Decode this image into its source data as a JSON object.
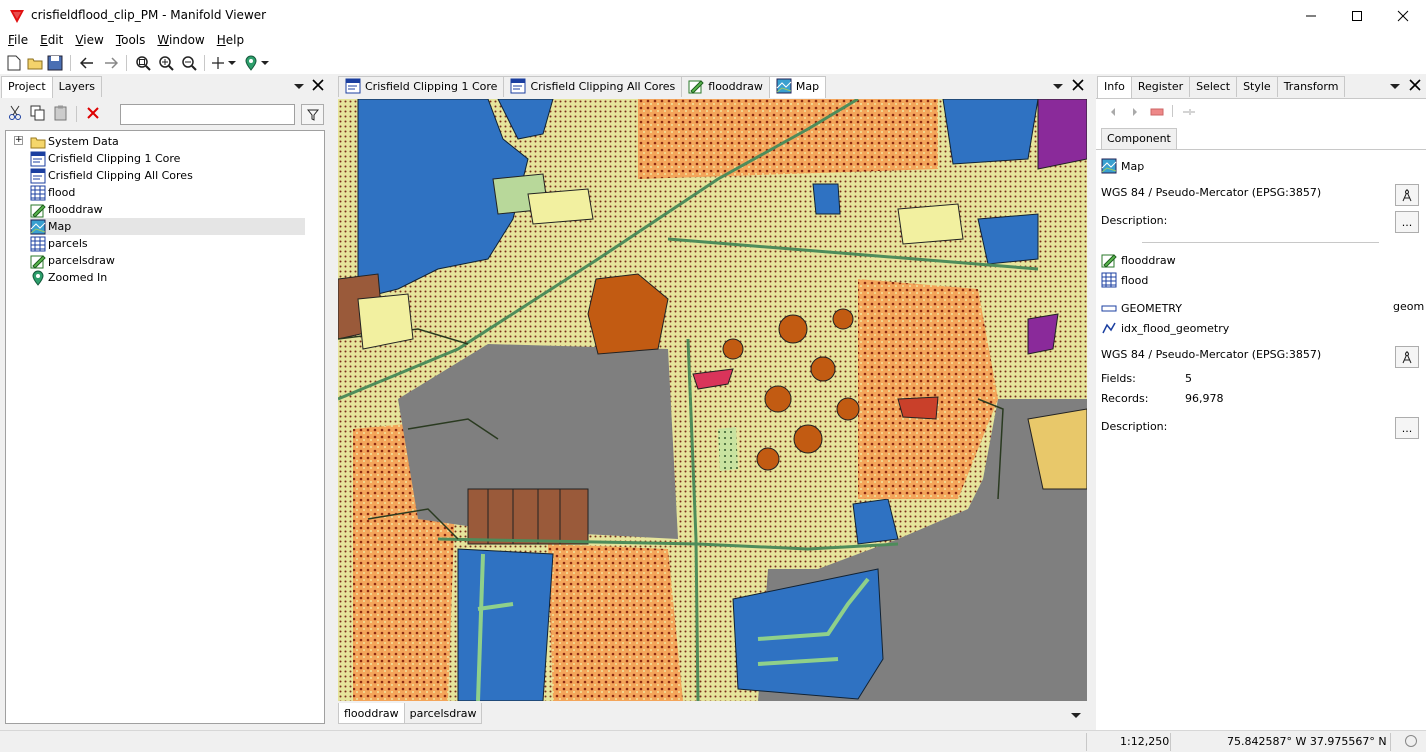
{
  "window": {
    "title": "crisfieldflood_clip_PM - Manifold Viewer",
    "accent": "#e01010"
  },
  "menu": [
    {
      "key": "F",
      "rest": "ile"
    },
    {
      "key": "E",
      "rest": "dit"
    },
    {
      "key": "V",
      "rest": "iew"
    },
    {
      "key": "T",
      "rest": "ools"
    },
    {
      "key": "W",
      "rest": "indow"
    },
    {
      "key": "H",
      "rest": "elp"
    }
  ],
  "left_panel": {
    "tabs": [
      "Project",
      "Layers"
    ],
    "filter_value": "",
    "items": [
      {
        "label": "System Data",
        "icon": "folder-icon"
      },
      {
        "label": "Crisfield Clipping 1 Core",
        "icon": "query-icon"
      },
      {
        "label": "Crisfield Clipping All Cores",
        "icon": "query-icon"
      },
      {
        "label": "flood",
        "icon": "table-icon"
      },
      {
        "label": "flooddraw",
        "icon": "drawing-icon"
      },
      {
        "label": "Map",
        "icon": "map-icon"
      },
      {
        "label": "parcels",
        "icon": "table-icon"
      },
      {
        "label": "parcelsdraw",
        "icon": "drawing-icon"
      },
      {
        "label": "Zoomed In",
        "icon": "location-icon"
      }
    ]
  },
  "center": {
    "tabs": [
      {
        "label": "Crisfield Clipping 1 Core",
        "icon": "query-icon"
      },
      {
        "label": "Crisfield Clipping All Cores",
        "icon": "query-icon"
      },
      {
        "label": "flooddraw",
        "icon": "drawing-icon"
      },
      {
        "label": "Map",
        "icon": "map-icon"
      }
    ],
    "layer_tabs": [
      "flooddraw",
      "parcelsdraw"
    ]
  },
  "right_panel": {
    "tabs": [
      "Info",
      "Register",
      "Select",
      "Style",
      "Transform"
    ],
    "subtab": "Component",
    "component": "Map",
    "crs1": "WGS 84 / Pseudo-Mercator (EPSG:3857)",
    "description_label": "Description:",
    "more_label": "...",
    "layer1": "flooddraw",
    "layer2": "flood",
    "geometry_label": "GEOMETRY",
    "geometry_type": "geom",
    "index_label": "idx_flood_geometry",
    "crs2": "WGS 84 / Pseudo-Mercator (EPSG:3857)",
    "fields_label": "Fields:",
    "fields_value": "5",
    "records_label": "Records:",
    "records_value": "96,978"
  },
  "status": {
    "scale": "1:12,250",
    "coords": "75.842587° W 37.975567° N"
  }
}
